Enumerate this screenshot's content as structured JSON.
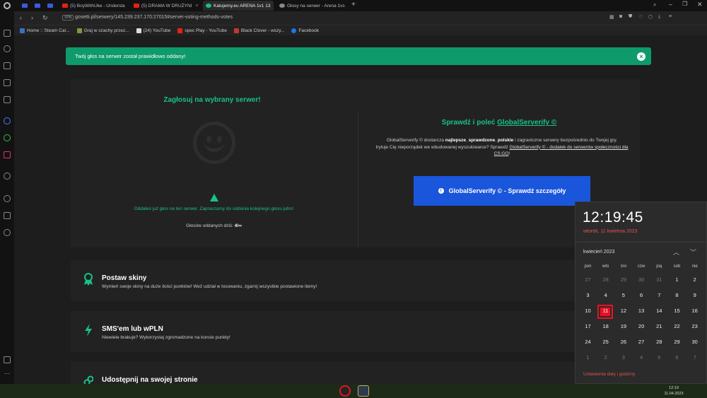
{
  "tabs": [
    {
      "label": "",
      "color": "#3b5bd9"
    },
    {
      "label": "",
      "color": "#3b5bd9"
    },
    {
      "label": "",
      "color": "#3b5bd9"
    },
    {
      "label": "(5) BoyWithUke - Understa",
      "color": "#e62117"
    },
    {
      "label": "(5) DRAMA W DRUŻYNI",
      "color": "#e62117"
    },
    {
      "label": "Katujemy.eu ARENA 1v1 13",
      "color": "#17c287"
    },
    {
      "label": "Głosy na serwer - Arena 1vs",
      "color": "#888888"
    }
  ],
  "address": {
    "vpn": "VPN",
    "url": "gosetti.pl/serwery/145.239.237.170:27015#server-voting-methods-votes"
  },
  "bookmarks": [
    {
      "label": "Home :: Steam Car...",
      "color": "#3b6fc9"
    },
    {
      "label": "Graj w szachy przez...",
      "color": "#7a9b3b"
    },
    {
      "label": "(24) YouTube",
      "color": "#dddddd"
    },
    {
      "label": "spec Play - YouTube",
      "color": "#e62117"
    },
    {
      "label": "Black Clover - wszy...",
      "color": "#c0392b"
    },
    {
      "label": "Facebook",
      "color": "#1877f2"
    }
  ],
  "alert": {
    "text": "Twój głos na serwer został prawidłowo oddany!",
    "close": "×"
  },
  "vote": {
    "title": "Zagłosuj na wybrany serwer!",
    "warning": "Oddałeś już głos na ten serwer. Zapraszamy do oddania kolejnego głosu jutro!",
    "votes_label": "Głosów oddanych dziś:",
    "votes_value": "4/∞"
  },
  "gs": {
    "title_prefix": "Sprawdź i poleć",
    "title_link": "GlobalServerify ©",
    "desc_1": "GlobalServerify © dostarcza",
    "desc_b1": "najlepsze",
    "desc_b2": "sprawdzone",
    "desc_b3": "polskie",
    "desc_2": "i zagraniczne serwery bezpośrednio do Twojej gry.",
    "desc_3": "Irytuje Cię nieporządek we wbudowanej wyszukiwarce? Sprawdź",
    "desc_link": "GlobalServerify © - dodatek do serwerów społeczności dla CS:GO",
    "button": "GlobalServerify © - Sprawdź szczegóły"
  },
  "features": [
    {
      "title": "Postaw skiny",
      "desc": "Wymień swoje skiny na duże ilości punktów! Weź udział w losowaniu, zgarnij wszystkie postawione itemy!"
    },
    {
      "title": "SMS'em lub wPLN",
      "desc": "Niewiele brakuje? Wykorzystaj zgromadzone na koncie punkty!"
    },
    {
      "title": "Udostępnij na swojej stronie",
      "desc": ""
    }
  ],
  "calendar": {
    "time": "12:19:45",
    "date_long": "wtorek, 11 kwietnia 2023",
    "month": "kwiecień 2023",
    "weekdays": [
      "pon",
      "wto",
      "śro",
      "czw",
      "pią",
      "sob",
      "nie"
    ],
    "weeks": [
      [
        "27",
        "28",
        "29",
        "30",
        "31",
        "1",
        "2"
      ],
      [
        "3",
        "4",
        "5",
        "6",
        "7",
        "8",
        "9"
      ],
      [
        "10",
        "11",
        "12",
        "13",
        "14",
        "15",
        "16"
      ],
      [
        "17",
        "18",
        "19",
        "20",
        "21",
        "22",
        "23"
      ],
      [
        "24",
        "25",
        "26",
        "27",
        "28",
        "29",
        "30"
      ],
      [
        "1",
        "2",
        "3",
        "4",
        "5",
        "6",
        "7"
      ]
    ],
    "settings": "Ustawienia daty i godziny"
  },
  "tray": {
    "time": "12:19",
    "date": "11.04.2023"
  }
}
